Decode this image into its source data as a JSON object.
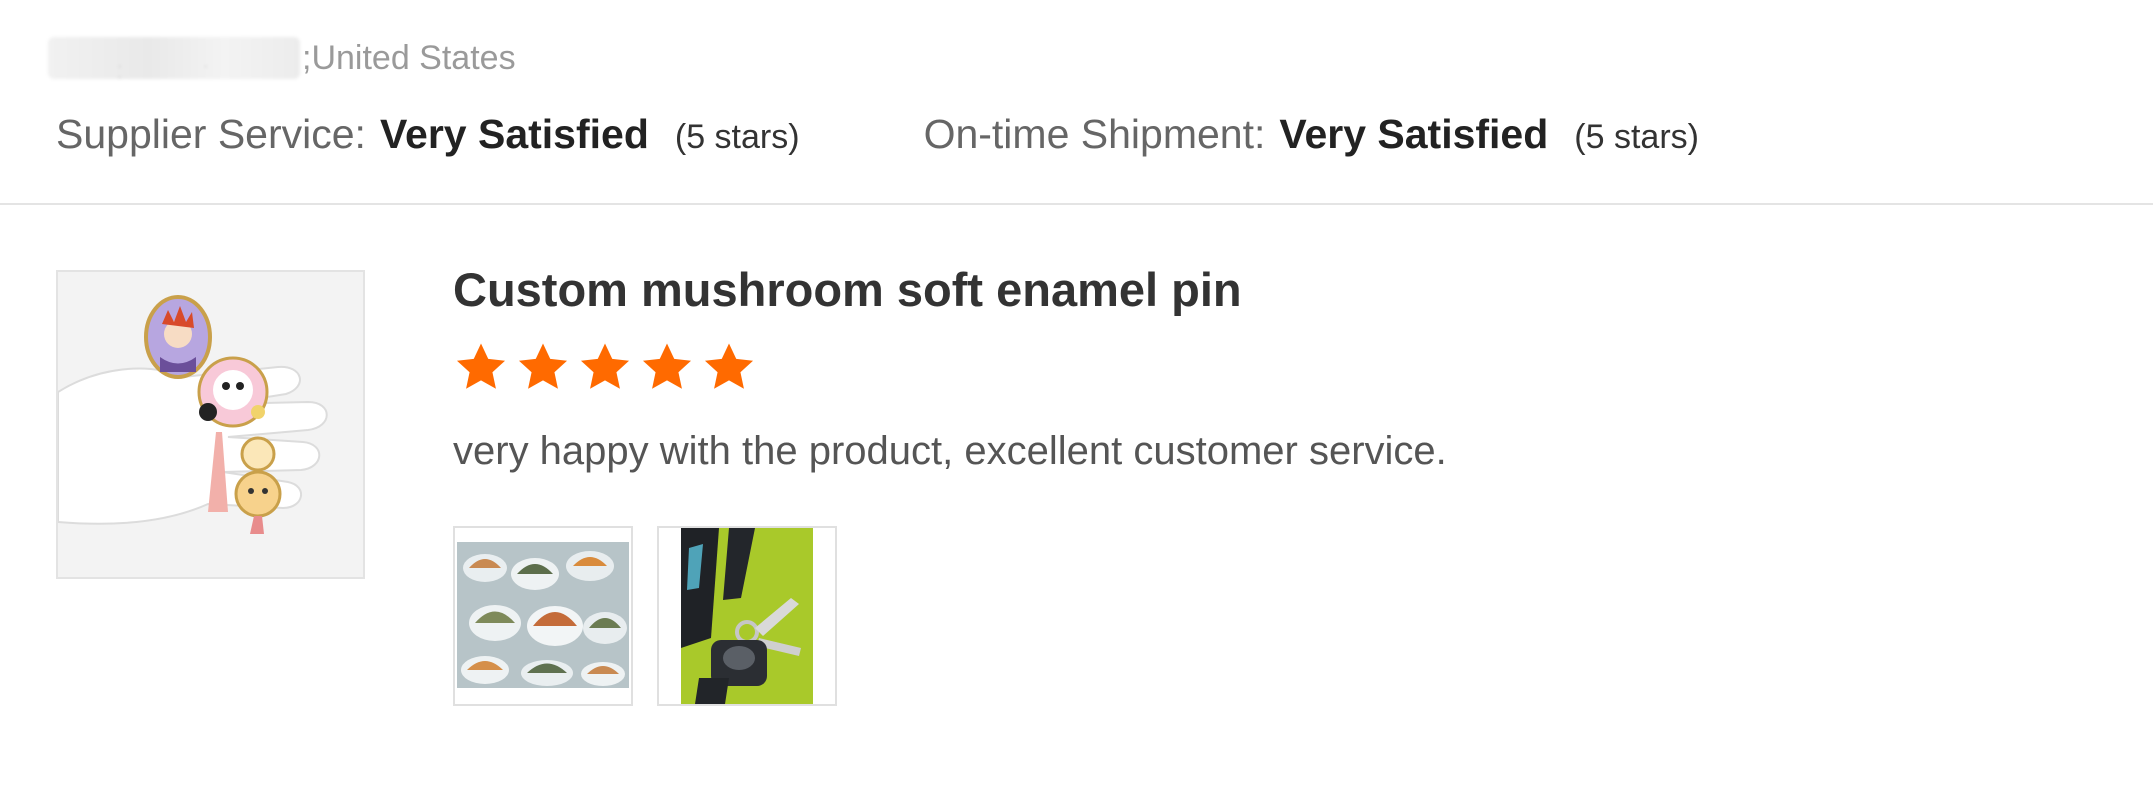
{
  "reviewer": {
    "location": ";United States"
  },
  "ratings": [
    {
      "label": "Supplier Service:",
      "value": "Very Satisfied",
      "count": "(5 stars)"
    },
    {
      "label": "On-time Shipment:",
      "value": "Very Satisfied",
      "count": "(5 stars)"
    }
  ],
  "review": {
    "product_title": "Custom mushroom soft enamel pin",
    "stars": 5,
    "star_color": "#ff6a00",
    "text": "very happy with the product, excellent customer service.",
    "photo_count": 2
  }
}
